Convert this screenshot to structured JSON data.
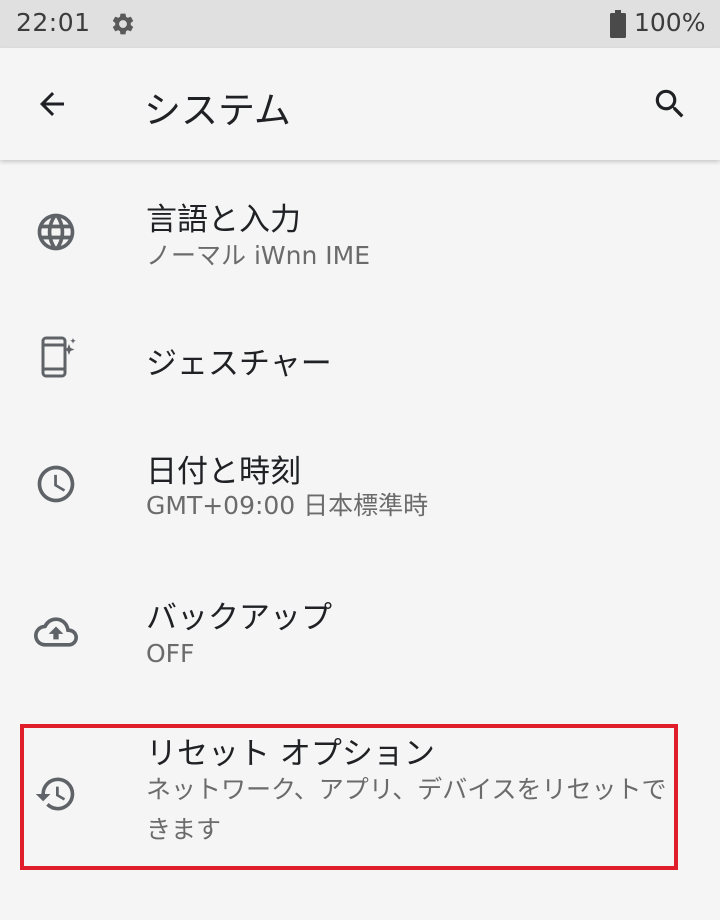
{
  "status_bar": {
    "time": "22:01",
    "battery": "100%",
    "icons": [
      "gear-icon",
      "battery-full-icon"
    ]
  },
  "app_bar": {
    "title": "システム",
    "back_icon": "arrow-back-icon",
    "search_icon": "search-icon"
  },
  "items": [
    {
      "icon": "globe-icon",
      "title": "言語と入力",
      "subtitle": "ノーマル iWnn IME"
    },
    {
      "icon": "gesture-phone-icon",
      "title": "ジェスチャー",
      "subtitle": ""
    },
    {
      "icon": "clock-icon",
      "title": "日付と時刻",
      "subtitle": "GMT+09:00 日本標準時"
    },
    {
      "icon": "cloud-upload-icon",
      "title": "バックアップ",
      "subtitle": "OFF"
    },
    {
      "icon": "history-icon",
      "title": "リセット オプション",
      "subtitle": "ネットワーク、アプリ、デバイスをリセットできます"
    }
  ],
  "colors": {
    "background": "#f5f5f5",
    "status_bar": "#e0e0e0",
    "highlight": "#e01e2a",
    "icon": "#5f6368"
  }
}
